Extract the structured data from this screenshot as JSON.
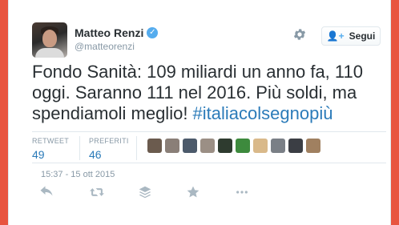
{
  "user": {
    "name": "Matteo Renzi",
    "handle": "@matteorenzi",
    "verified_icon": "verified-badge-icon"
  },
  "follow_button": {
    "label": "Segui",
    "icon": "add-user-icon"
  },
  "settings_icon": "gear-icon",
  "tweet": {
    "text": "Fondo Sanità: 109 miliardi un anno fa, 110 oggi. Saranno 111 nel 2016. Più soldi, ma spendiamoli meglio! ",
    "hashtag": "#italiacolsegnopiù"
  },
  "stats": {
    "retweet_label": "RETWEET",
    "retweet_count": "49",
    "favorites_label": "PREFERITI",
    "favorites_count": "46"
  },
  "likers": [
    {
      "color": "#6b5b4e"
    },
    {
      "color": "#8a7f78"
    },
    {
      "color": "#4c5a6b"
    },
    {
      "color": "#9b8f85"
    },
    {
      "color": "#2e3b2f"
    },
    {
      "color": "#3d8a3d"
    },
    {
      "color": "#d9b98a"
    },
    {
      "color": "#7a7f86"
    },
    {
      "color": "#3b3e44"
    },
    {
      "color": "#a08060"
    }
  ],
  "timestamp": "15:37 - 15 ott 2015",
  "actions": [
    "reply-icon",
    "retweet-icon",
    "stack-icon",
    "star-icon",
    "more-icon"
  ],
  "colors": {
    "background": "#e8543f",
    "link": "#2b7bb9",
    "twitter_blue": "#55acee",
    "muted": "#8899a6"
  }
}
